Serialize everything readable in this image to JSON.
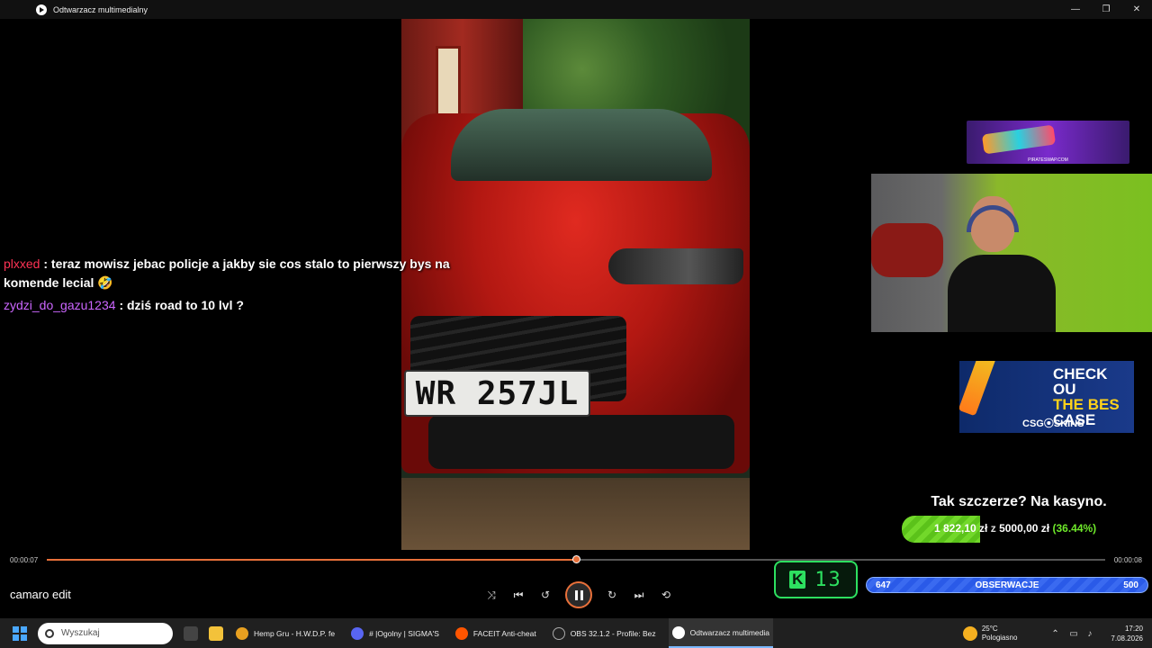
{
  "window": {
    "title": "Odtwarzacz multimedialny",
    "minimize": "—",
    "maximize": "❐",
    "close": "✕"
  },
  "video": {
    "plate": "WR 257JL"
  },
  "chat": [
    {
      "user": "plxxed",
      "message": ": teraz mowisz jebac policje a jakby sie cos stalo to pierwszy bys na komende lecial 🤣"
    },
    {
      "user": "zydzi_do_gazu1234",
      "message": ": dziś road to 10 lvl ?"
    }
  ],
  "overlays": {
    "pirateswap_label": "PIRATESWAP.COM",
    "csgo_line1": "CHECK OU",
    "csgo_line2": "THE BES",
    "csgo_line3": "CASE",
    "csgo_brand": "CSG⦿SKINS",
    "kasyno_text": "Tak szczerze? Na kasyno.",
    "progress_amount": "1 822,10 zł",
    "progress_of": "z",
    "progress_goal": "5000,00 zł",
    "progress_pct": "(36.44%)",
    "progress_fraction": 0.3644,
    "faceit_letter": "K",
    "faceit_level": "13",
    "obs_left": "647",
    "obs_label": "OBSERWACJE",
    "obs_right": "500"
  },
  "player": {
    "time_current": "00:00:07",
    "time_total": "00:00:08",
    "progress_fraction": 0.5,
    "media_title": "camaro edit",
    "controls": {
      "shuffle": "⤨",
      "prev": "⏮",
      "rewind": "↺",
      "forward": "↻",
      "next": "⏭",
      "repeat": "⟲"
    }
  },
  "taskbar": {
    "search_placeholder": "Wyszukaj",
    "items": [
      {
        "label": "Hemp Gru - H.W.D.P. fe",
        "color": "#e8a020"
      },
      {
        "label": "# |Ogolny | SIGMA'S",
        "color": "#5865f2"
      },
      {
        "label": "FACEIT Anti-cheat",
        "color": "#ff5500"
      },
      {
        "label": "OBS 32.1.2 - Profile: Bez",
        "color": "#222"
      },
      {
        "label": "Odtwarzacz multimedia",
        "color": "#fff"
      }
    ],
    "weather_temp": "25°C",
    "weather_desc": "Pologiasno",
    "time": "17:20",
    "date": "7.08.2026"
  }
}
